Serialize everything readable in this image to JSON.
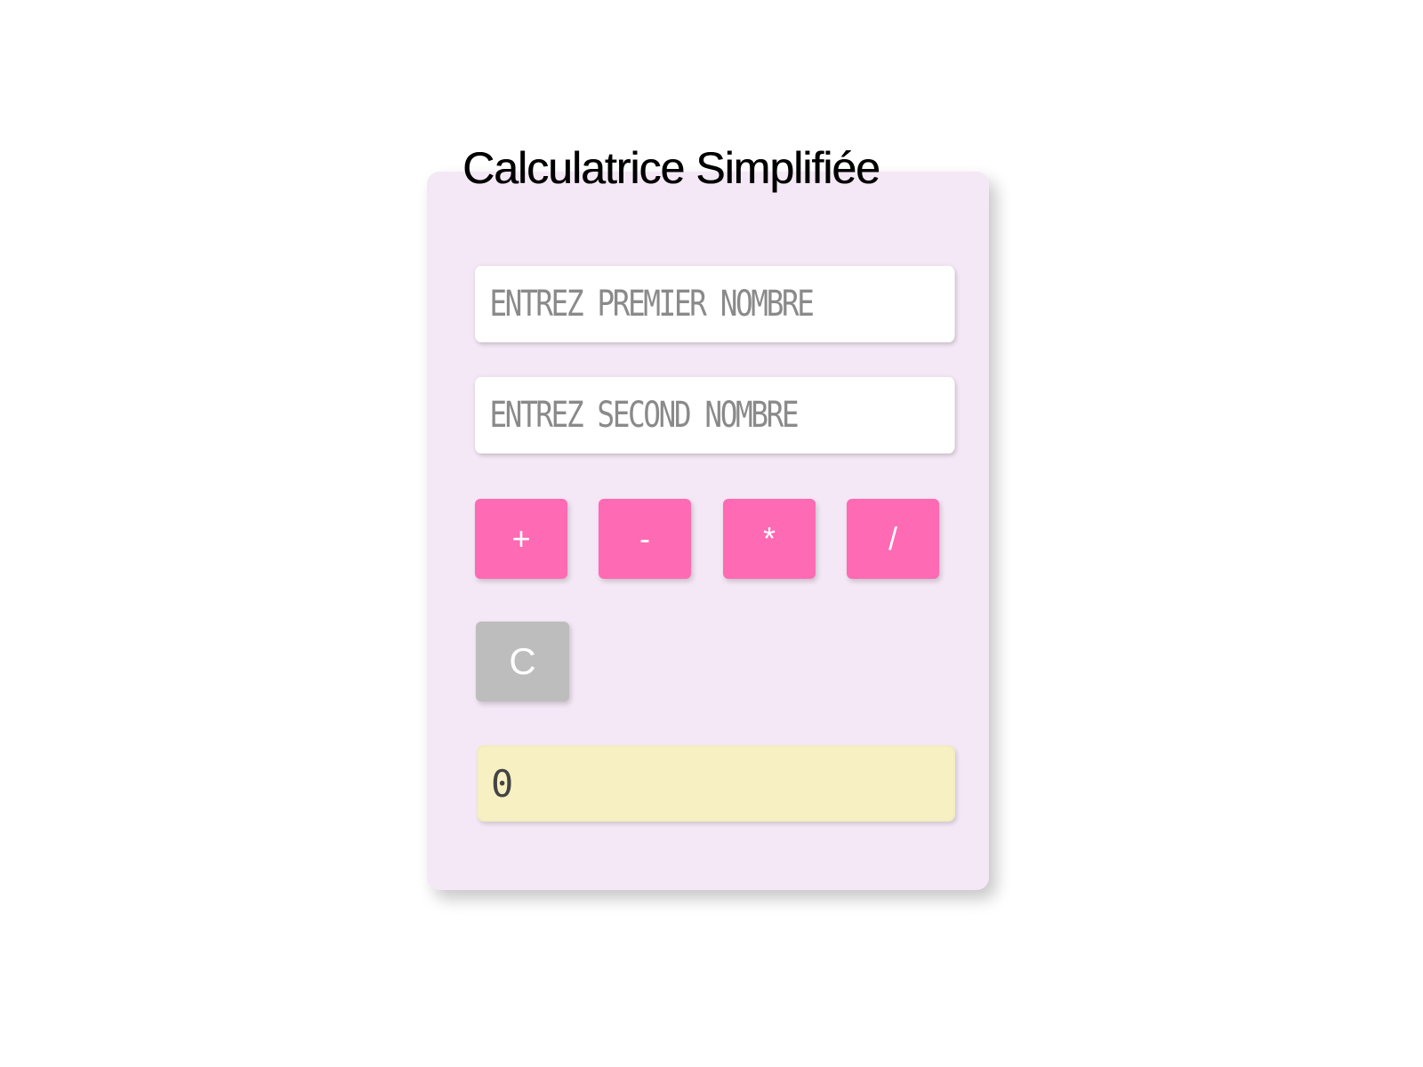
{
  "app": {
    "title": "Calculatrice Simplifiée"
  },
  "inputs": {
    "first": {
      "placeholder": "ENTREZ PREMIER NOMBRE",
      "value": ""
    },
    "second": {
      "placeholder": "ENTREZ SECOND NOMBRE",
      "value": ""
    }
  },
  "operations": {
    "add": "+",
    "subtract": "-",
    "multiply": "*",
    "divide": "/"
  },
  "clear_label": "C",
  "result": {
    "value": "0"
  },
  "colors": {
    "card": "#f5e8f6",
    "operator_button": "#ff6ab4",
    "clear_button": "#bdbdbd",
    "result_display": "#f7f0c2"
  }
}
